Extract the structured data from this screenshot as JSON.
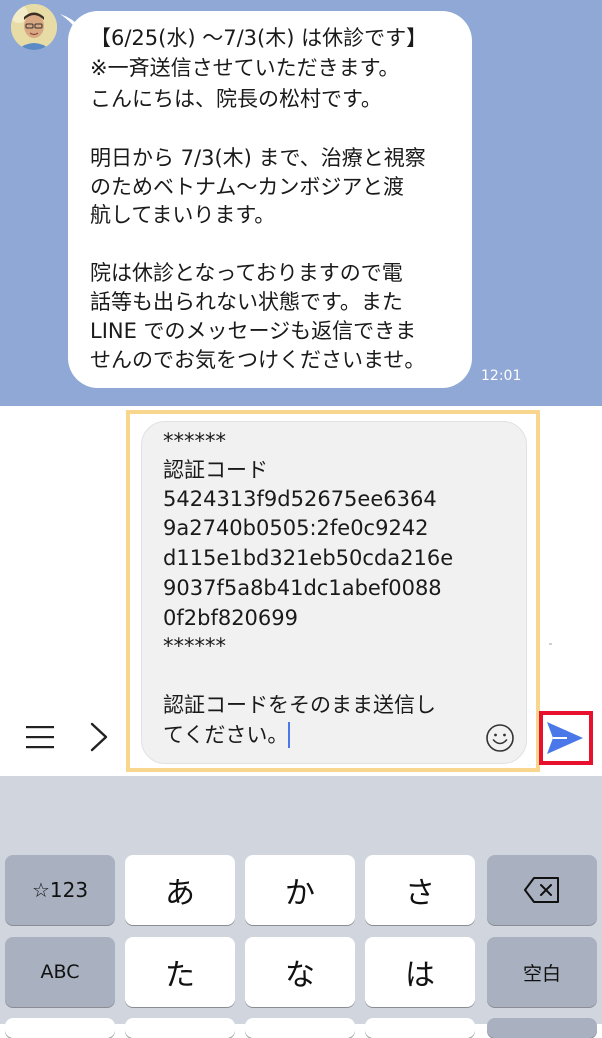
{
  "message": {
    "lines": [
      "【6/25(水) ～7/3(木) は休診です】",
      "※一斉送信させていただきます。",
      "こんにちは、院長の松村です。",
      "",
      "明日から 7/3(木) まで、治療と視察",
      "のためベトナム～カンボジアと渡",
      "航してまいります。",
      "",
      "院は休診となっておりますので電",
      "話等も出られない状態です。また",
      "LINE でのメッセージも返信できま",
      "せんのでお気をつけくださいませ。"
    ],
    "time": "12:01"
  },
  "input": {
    "lines": [
      "******",
      "認証コード",
      "5424313f9d52675ee6364",
      "9a2740b0505:2fe0c9242",
      "d115e1bd321eb50cda216e",
      "9037f5a8b41dc1abef0088",
      "0f2bf820699",
      "******",
      "",
      "認証コードをそのまま送信し",
      "てください。"
    ]
  },
  "keyboard": {
    "row1": [
      "☆123",
      "あ",
      "か",
      "さ"
    ],
    "row2": [
      "ABC",
      "た",
      "な",
      "は",
      "空白"
    ]
  },
  "colors": {
    "chat_bg": "#8fa8d6",
    "highlight_border": "#f9d68d",
    "send_border": "#e8112d",
    "send_icon": "#4a78e8",
    "keyboard_bg": "#d1d5de"
  }
}
